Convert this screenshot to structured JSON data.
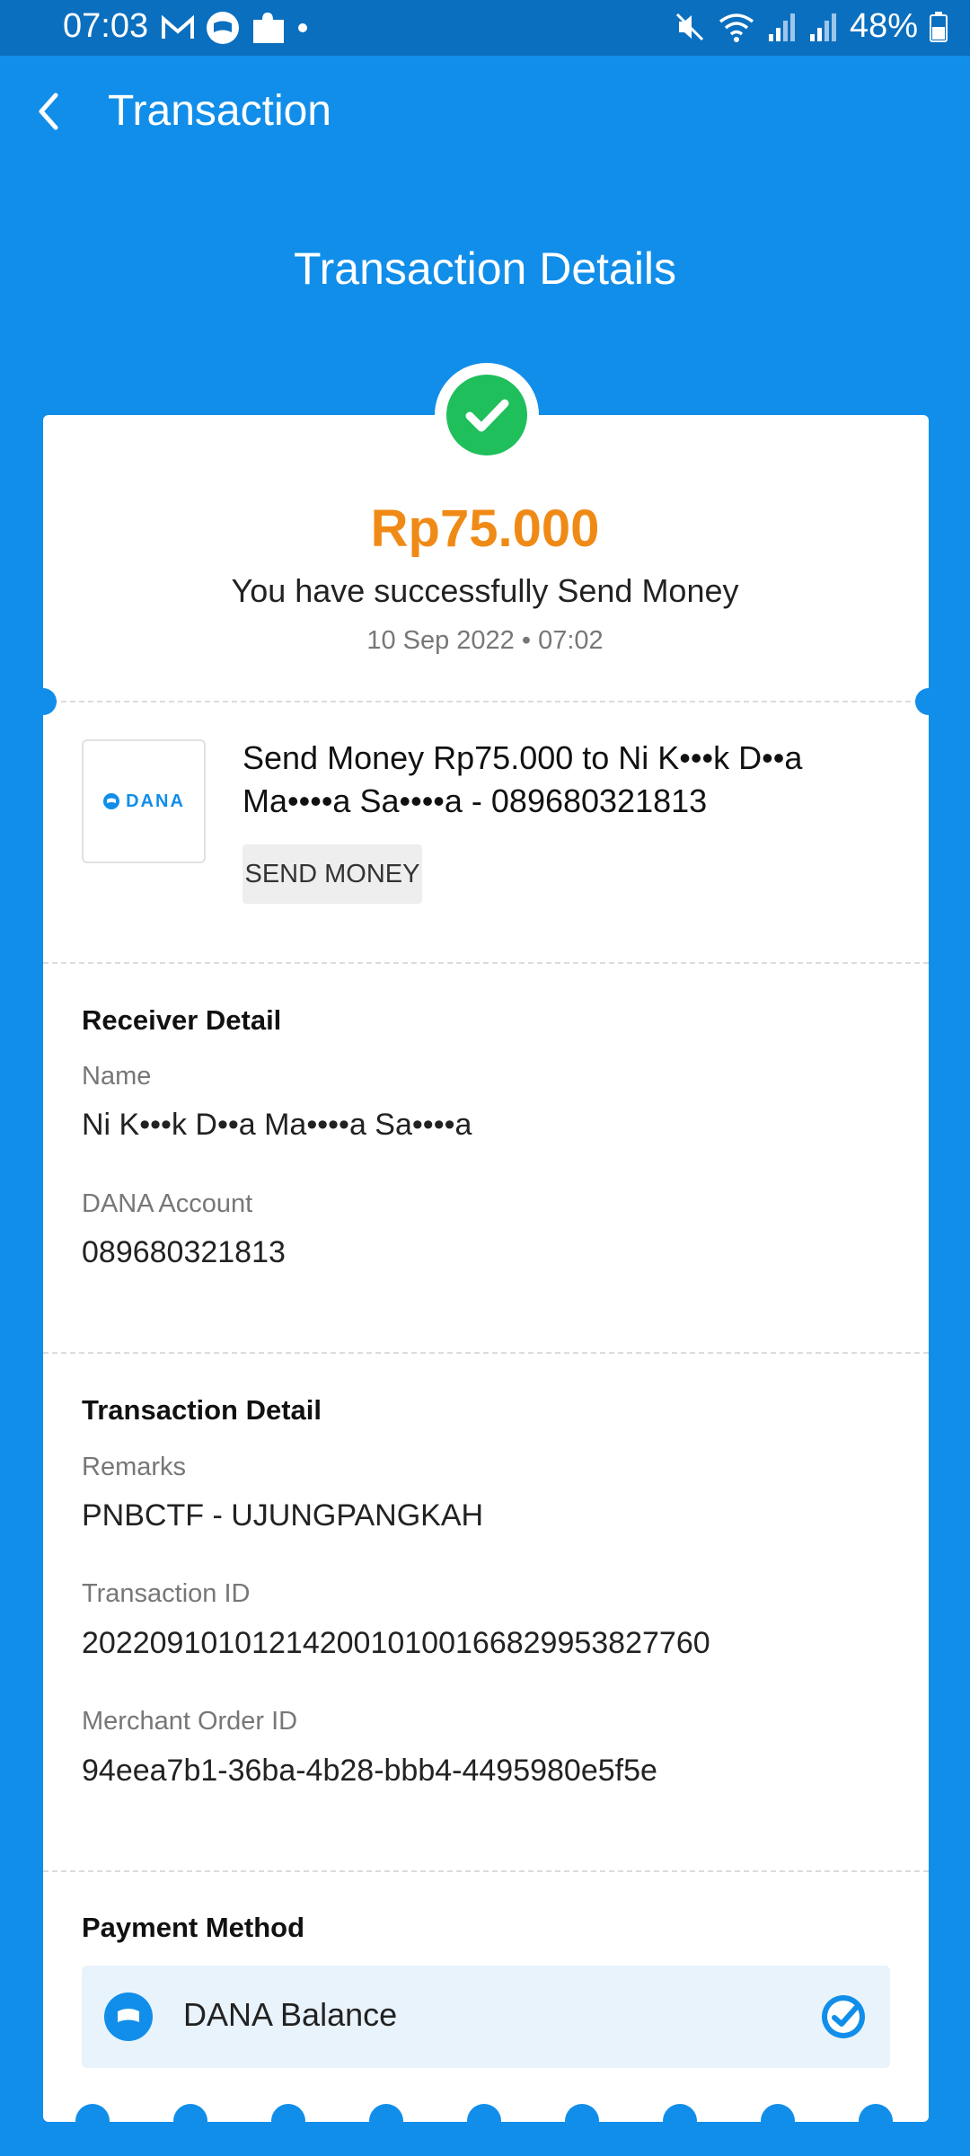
{
  "status_bar": {
    "time": "07:03",
    "battery": "48%"
  },
  "app_bar": {
    "title": "Transaction"
  },
  "page": {
    "heading": "Transaction Details"
  },
  "summary": {
    "amount": "Rp75.000",
    "message": "You have successfully Send Money",
    "datetime": "10 Sep 2022 • 07:02"
  },
  "transaction": {
    "logo_text": "DANA",
    "title": "Send Money Rp75.000 to Ni K•••k D••a Ma••••a Sa••••a - 089680321813",
    "tag": "SEND MONEY"
  },
  "receiver": {
    "section_title": "Receiver Detail",
    "name_label": "Name",
    "name_value": "Ni K•••k D••a Ma••••a Sa••••a",
    "account_label": "DANA Account",
    "account_value": "089680321813"
  },
  "transaction_detail": {
    "section_title": "Transaction Detail",
    "remarks_label": "Remarks",
    "remarks_value": "PNBCTF - UJUNGPANGKAH",
    "id_label": "Transaction ID",
    "id_value": "2022091010121420010100166829953827760",
    "order_label": "Merchant Order ID",
    "order_value": "94eea7b1-36ba-4b28-bbb4-4495980e5f5e"
  },
  "payment": {
    "section_title": "Payment Method",
    "method": "DANA Balance"
  },
  "colors": {
    "primary_blue": "#118ee9",
    "status_bar_blue": "#0b6fbf",
    "amount_orange": "#f08a16",
    "success_green": "#1fbf5b"
  },
  "icons": [
    "gmail-icon",
    "dana-notification-icon",
    "puzzle-icon",
    "mute-icon",
    "wifi-icon",
    "signal-icon",
    "battery-icon",
    "back-arrow-icon",
    "success-check-icon",
    "dana-wallet-icon",
    "selected-check-icon"
  ]
}
